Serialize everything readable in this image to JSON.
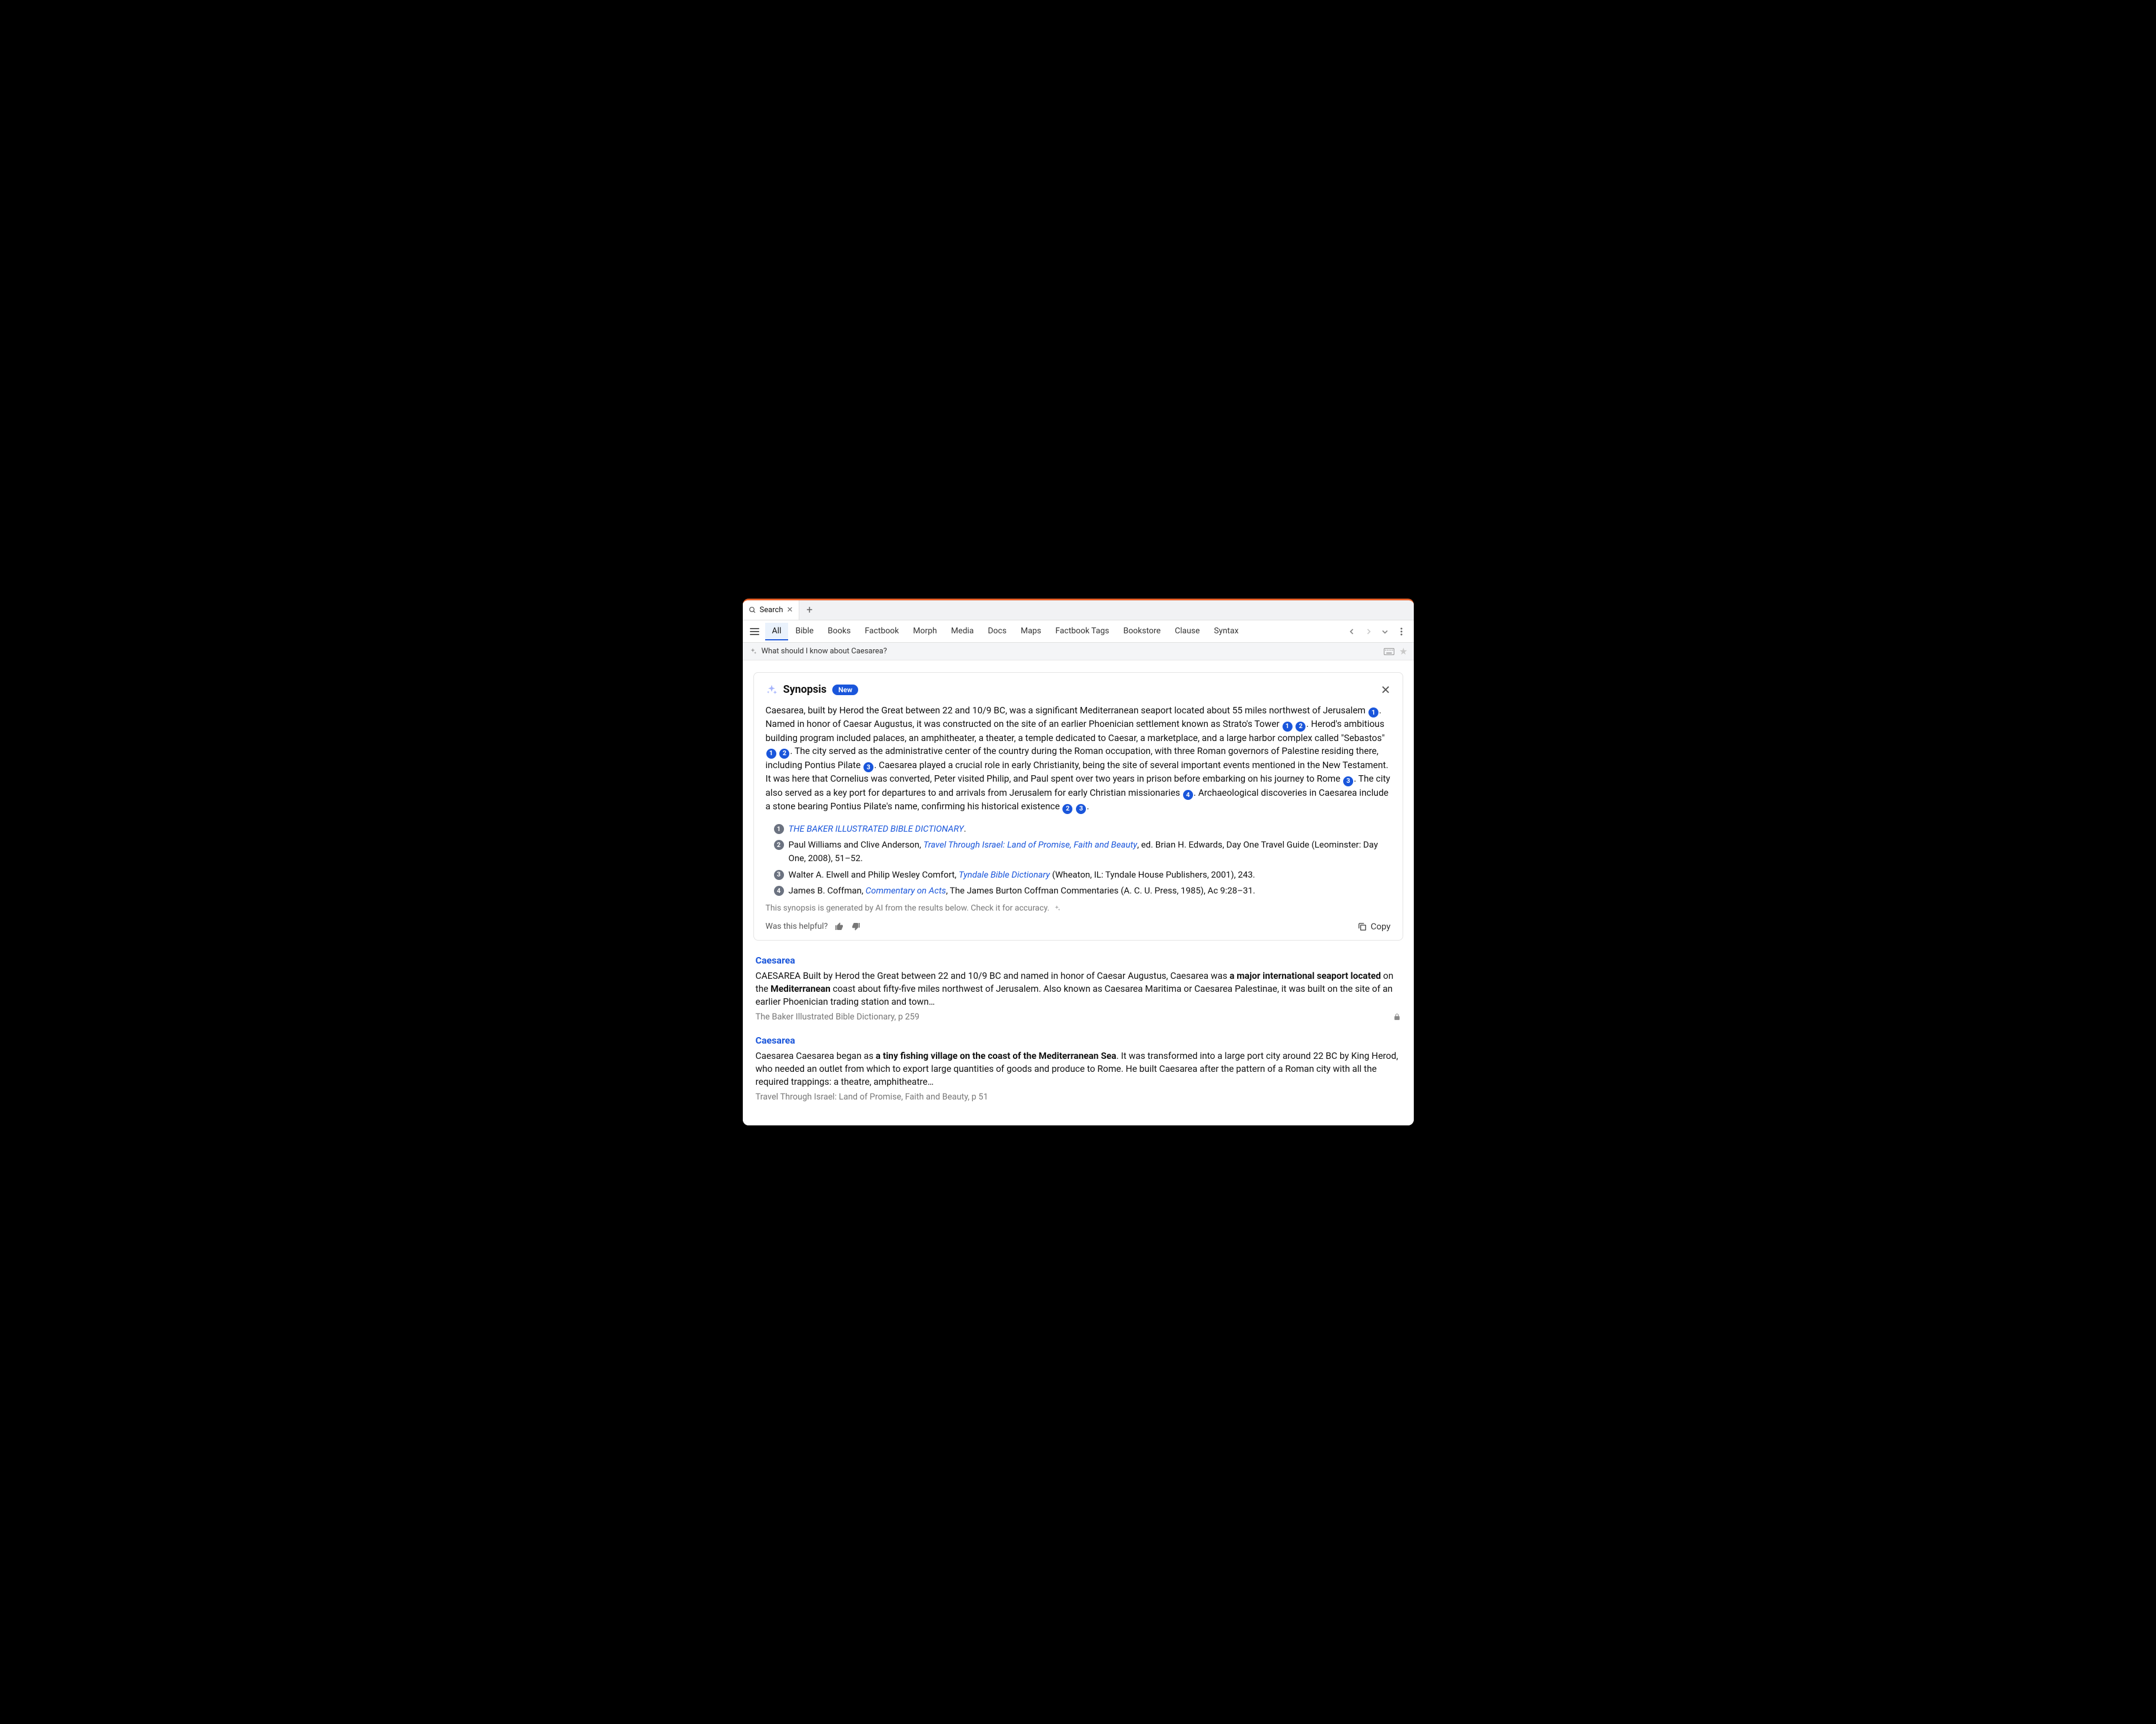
{
  "tab": {
    "label": "Search"
  },
  "toolbar": {
    "items": [
      "All",
      "Bible",
      "Books",
      "Factbook",
      "Morph",
      "Media",
      "Docs",
      "Maps",
      "Factbook Tags",
      "Bookstore",
      "Clause",
      "Syntax"
    ],
    "active_index": 0
  },
  "query": {
    "text": "What should I know about Caesarea?"
  },
  "synopsis": {
    "title": "Synopsis",
    "badge": "New",
    "segments": [
      {
        "text": "Caesarea, built by Herod the Great between 22 and 10/9 BC, was a significant Mediterranean seaport located about 55 miles northwest of Jerusalem "
      },
      {
        "cite": 1
      },
      {
        "text": ". Named in honor of Caesar Augustus, it was constructed on the site of an earlier Phoenician settlement known as Strato's Tower "
      },
      {
        "cite": 1
      },
      {
        "text": " "
      },
      {
        "cite": 2
      },
      {
        "text": ". Herod's ambitious building program included palaces, an amphitheater, a theater, a temple dedicated to Caesar, a marketplace, and a large harbor complex called \"Sebastos\" "
      },
      {
        "cite": 1
      },
      {
        "text": " "
      },
      {
        "cite": 2
      },
      {
        "text": ". The city served as the administrative center of the country during the Roman occupation, with three Roman governors of Palestine residing there, including Pontius Pilate "
      },
      {
        "cite": 3
      },
      {
        "text": ". Caesarea played a crucial role in early Christianity, being the site of several important events mentioned in the New Testament. It was here that Cornelius was converted, Peter visited Philip, and Paul spent over two years in prison before embarking on his journey to Rome "
      },
      {
        "cite": 3
      },
      {
        "text": ". The city also served as a key port for departures to and arrivals from Jerusalem for early Christian missionaries "
      },
      {
        "cite": 4
      },
      {
        "text": ". Archaeological discoveries in Caesarea include a stone bearing Pontius Pilate's name, confirming his historical existence "
      },
      {
        "cite": 2
      },
      {
        "text": " "
      },
      {
        "cite": 3
      },
      {
        "text": "."
      }
    ],
    "references": [
      {
        "num": 1,
        "prefix": "",
        "link": "THE BAKER ILLUSTRATED BIBLE DICTIONARY",
        "suffix": "."
      },
      {
        "num": 2,
        "prefix": "Paul Williams and Clive Anderson, ",
        "link": "Travel Through Israel: Land of Promise, Faith and Beauty",
        "suffix": ", ed. Brian H. Edwards, Day One Travel Guide (Leominster: Day One, 2008), 51–52."
      },
      {
        "num": 3,
        "prefix": "Walter A. Elwell and Philip Wesley Comfort, ",
        "link": "Tyndale Bible Dictionary",
        "suffix": " (Wheaton, IL: Tyndale House Publishers, 2001), 243."
      },
      {
        "num": 4,
        "prefix": "James B. Coffman, ",
        "link": "Commentary on Acts",
        "suffix": ", The James Burton Coffman Commentaries (A. C. U. Press, 1985), Ac 9:28–31."
      }
    ],
    "ai_note": "This synopsis is generated by AI from the results below. Check it for accuracy.",
    "helpful_label": "Was this helpful?",
    "copy_label": "Copy"
  },
  "results": [
    {
      "title": "Caesarea",
      "snippet_parts": [
        {
          "text": "CAESAREA Built by Herod the Great between 22 and 10/9 BC and named in honor of Caesar Augustus, Caesarea was "
        },
        {
          "bold": "a major international seaport located"
        },
        {
          "text": " on the "
        },
        {
          "bold": "Mediterranean"
        },
        {
          "text": " coast about fifty-five miles northwest of Jerusalem. Also known as Caesarea Maritima or Caesarea Palestinae, it was built on the site of an earlier Phoenician trading station and town…"
        }
      ],
      "source": "The Baker Illustrated Bible Dictionary, p 259",
      "locked": true
    },
    {
      "title": "Caesarea",
      "snippet_parts": [
        {
          "text": "Caesarea Caesarea began as "
        },
        {
          "bold": "a tiny fishing village on the coast of the Mediterranean Sea"
        },
        {
          "text": ". It was transformed into a large port city around 22 BC by King Herod, who needed an outlet from which to export large quantities of goods and produce to Rome. He built Caesarea after the pattern of a Roman city with all the required trappings: a theatre, amphitheatre…"
        }
      ],
      "source": "Travel Through Israel: Land of Promise, Faith and Beauty, p 51",
      "locked": false
    }
  ]
}
